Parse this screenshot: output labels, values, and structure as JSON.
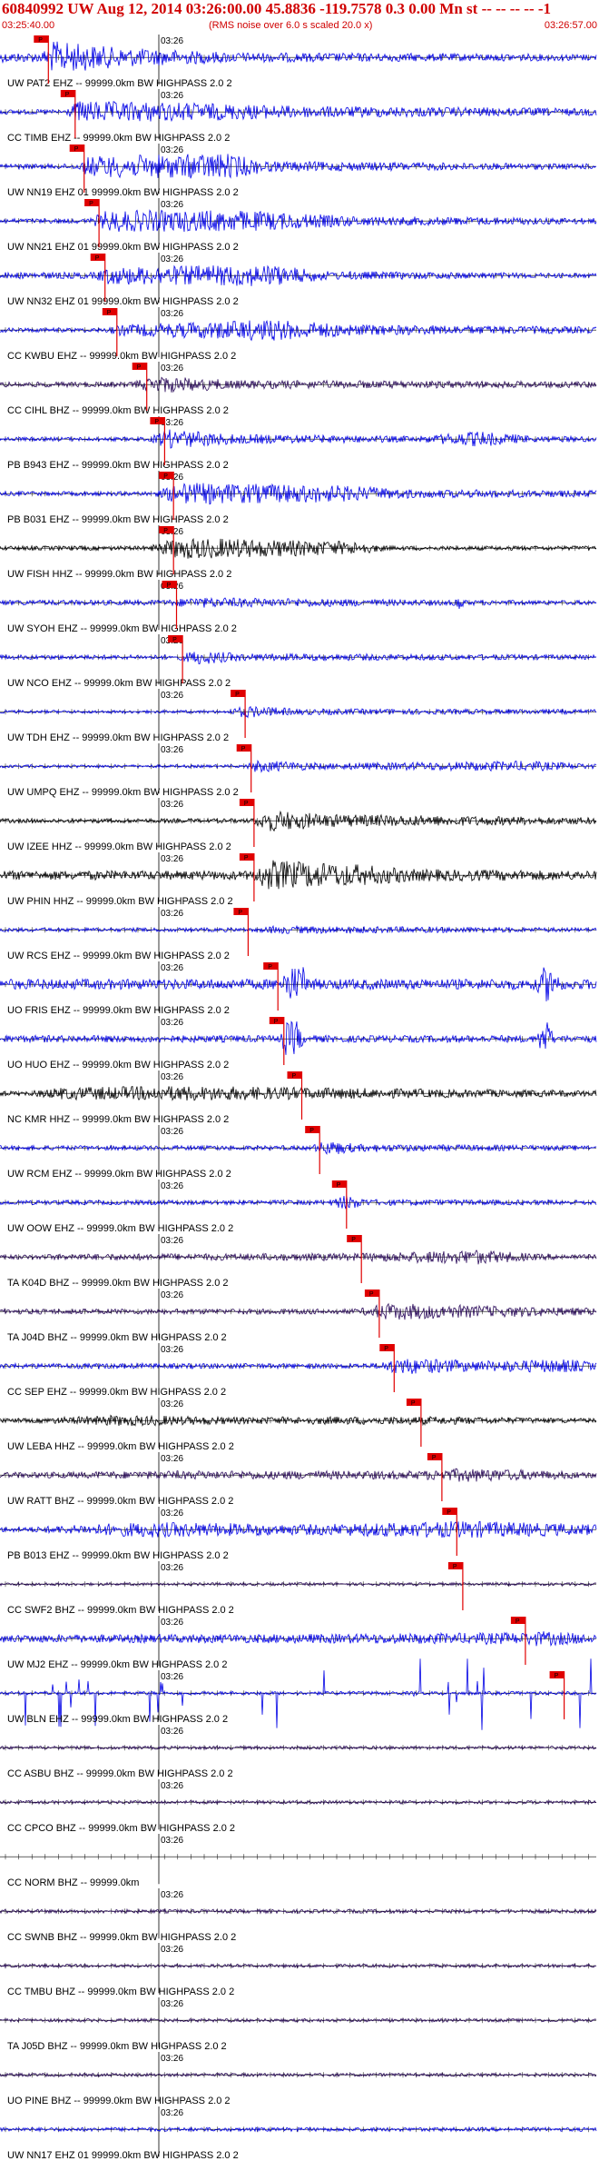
{
  "header": {
    "title": "60840992 UW Aug 12, 2014 03:26:00.00   45.8836 -119.7578  0.3 0.00 Mn st -- -- -- --  -1",
    "start_time": "03:25:40.00",
    "note": "(RMS noise over 6.0 s scaled 20.0 x)",
    "end_time": "03:26:57.00"
  },
  "colors": {
    "red": "#d00000",
    "blue": "#0000e6",
    "black": "#000000",
    "purple": "#2a0a5a",
    "pick": "#e00000"
  },
  "chart_data": {
    "type": "line",
    "time_label": "03:26",
    "pick_label": "P",
    "traces": [
      {
        "label": "UW PAT2 EHZ -- 99999.0km BW  HIGHPASS  2.0  2",
        "color": "blue",
        "amp": 3.0,
        "env": [
          [
            0.07,
            0.3
          ],
          [
            0.09,
            1.0
          ],
          [
            0.2,
            0.6
          ],
          [
            0.4,
            0.3
          ],
          [
            1.0,
            0.2
          ]
        ],
        "pick": 0.075
      },
      {
        "label": "CC TIMB EHZ -- 99999.0km BW  HIGHPASS  2.0  2",
        "color": "blue",
        "amp": 2.2,
        "env": [
          [
            0.11,
            0.2
          ],
          [
            0.13,
            0.9
          ],
          [
            0.3,
            0.8
          ],
          [
            0.5,
            0.5
          ],
          [
            1.0,
            0.3
          ]
        ],
        "pick": 0.12
      },
      {
        "label": "UW NN19 EHZ 01 99999.0km BW  HIGHPASS  2.0  2",
        "color": "blue",
        "amp": 2.4,
        "env": [
          [
            0.13,
            0.2
          ],
          [
            0.15,
            0.8
          ],
          [
            0.38,
            1.0
          ],
          [
            0.45,
            0.4
          ],
          [
            1.0,
            0.2
          ]
        ],
        "pick": 0.135
      },
      {
        "label": "UW NN21 EHZ 01 99999.0km BW  HIGHPASS  2.0  2",
        "color": "blue",
        "amp": 2.2,
        "env": [
          [
            0.15,
            0.2
          ],
          [
            0.18,
            0.9
          ],
          [
            0.4,
            0.9
          ],
          [
            0.6,
            0.4
          ],
          [
            1.0,
            0.25
          ]
        ],
        "pick": 0.16
      },
      {
        "label": "UW NN32 EHZ 01 99999.0km BW  HIGHPASS  2.0  2",
        "color": "blue",
        "amp": 2.0,
        "env": [
          [
            0.16,
            0.3
          ],
          [
            0.18,
            0.8
          ],
          [
            0.45,
            1.0
          ],
          [
            0.55,
            0.4
          ],
          [
            1.0,
            0.2
          ]
        ],
        "pick": 0.17
      },
      {
        "label": "CC KWBU EHZ -- 99999.0km BW  HIGHPASS  2.0  2",
        "color": "blue",
        "amp": 2.0,
        "env": [
          [
            0.18,
            0.2
          ],
          [
            0.2,
            0.5
          ],
          [
            0.45,
            1.0
          ],
          [
            0.6,
            0.5
          ],
          [
            1.0,
            0.3
          ]
        ],
        "pick": 0.19
      },
      {
        "label": "CC CIHL BHZ -- 99999.0km BW  HIGHPASS  2.0  2",
        "color": "purple",
        "amp": 1.6,
        "env": [
          [
            0.22,
            0.3
          ],
          [
            0.26,
            1.0
          ],
          [
            0.4,
            0.5
          ],
          [
            1.0,
            0.35
          ]
        ],
        "pick": 0.24
      },
      {
        "label": "PB B943 EHZ -- 99999.0km BW  HIGHPASS  2.0  2",
        "color": "blue",
        "amp": 1.8,
        "env": [
          [
            0.25,
            0.2
          ],
          [
            0.28,
            1.0
          ],
          [
            0.4,
            0.5
          ],
          [
            0.7,
            0.3
          ],
          [
            0.8,
            0.8
          ],
          [
            0.9,
            0.3
          ],
          [
            1.0,
            0.3
          ]
        ],
        "pick": 0.27
      },
      {
        "label": "PB B031 EHZ -- 99999.0km BW  HIGHPASS  2.0  2",
        "color": "blue",
        "amp": 2.0,
        "env": [
          [
            0.26,
            0.2
          ],
          [
            0.3,
            1.0
          ],
          [
            0.55,
            0.8
          ],
          [
            0.7,
            0.4
          ],
          [
            1.0,
            0.3
          ]
        ],
        "pick": 0.285
      },
      {
        "label": "UW FISH HHZ -- 99999.0km BW  HIGHPASS  2.0  2",
        "color": "black",
        "amp": 2.0,
        "env": [
          [
            0.25,
            0.2
          ],
          [
            0.3,
            1.0
          ],
          [
            0.45,
            0.8
          ],
          [
            0.6,
            0.6
          ],
          [
            0.65,
            0.2
          ],
          [
            1.0,
            0.2
          ]
        ],
        "pick": 0.285
      },
      {
        "label": "UW SYOH EHZ -- 99999.0km BW  HIGHPASS  2.0  2",
        "color": "blue",
        "amp": 1.6,
        "env": [
          [
            0.28,
            0.3
          ],
          [
            0.32,
            0.6
          ],
          [
            0.76,
            0.3
          ],
          [
            0.77,
            1.0
          ],
          [
            0.78,
            0.3
          ],
          [
            1.0,
            0.25
          ]
        ],
        "pick": 0.29
      },
      {
        "label": "UW NCO EHZ -- 99999.0km BW  HIGHPASS  2.0  2",
        "color": "blue",
        "amp": 1.4,
        "env": [
          [
            0.3,
            0.3
          ],
          [
            0.33,
            1.0
          ],
          [
            0.4,
            0.5
          ],
          [
            1.0,
            0.3
          ]
        ],
        "pick": 0.3
      },
      {
        "label": "UW TDH EHZ -- 99999.0km BW  HIGHPASS  2.0  2",
        "color": "blue",
        "amp": 1.4,
        "env": [
          [
            0.38,
            0.2
          ],
          [
            0.41,
            0.8
          ],
          [
            0.5,
            0.4
          ],
          [
            1.0,
            0.3
          ]
        ],
        "pick": 0.405
      },
      {
        "label": "UW UMPQ EHZ -- 99999.0km BW  HIGHPASS  2.0  2",
        "color": "blue",
        "amp": 1.4,
        "env": [
          [
            0.41,
            0.2
          ],
          [
            0.43,
            0.8
          ],
          [
            0.55,
            0.4
          ],
          [
            0.88,
            0.7
          ],
          [
            1.0,
            0.3
          ]
        ],
        "pick": 0.415
      },
      {
        "label": "UW IZEE HHZ -- 99999.0km BW  HIGHPASS  2.0  2",
        "color": "black",
        "amp": 2.0,
        "env": [
          [
            0.42,
            0.2
          ],
          [
            0.45,
            1.0
          ],
          [
            0.55,
            0.6
          ],
          [
            1.0,
            0.3
          ]
        ],
        "pick": 0.42
      },
      {
        "label": "UW PHIN HHZ -- 99999.0km BW  HIGHPASS  2.0  2",
        "color": "black",
        "amp": 2.8,
        "env": [
          [
            0.42,
            0.3
          ],
          [
            0.45,
            1.0
          ],
          [
            0.6,
            0.7
          ],
          [
            0.7,
            0.4
          ],
          [
            1.0,
            0.3
          ]
        ],
        "pick": 0.42
      },
      {
        "label": "UW RCS EHZ -- 99999.0km BW  HIGHPASS  2.0  2",
        "color": "blue",
        "amp": 1.2,
        "env": [
          [
            0.43,
            0.3
          ],
          [
            0.46,
            0.6
          ],
          [
            1.0,
            0.3
          ]
        ],
        "pick": 0.41
      },
      {
        "label": "UO FRIS EHZ -- 99999.0km BW  HIGHPASS  2.0  2",
        "color": "blue",
        "amp": 3.2,
        "env": [
          [
            0.47,
            0.3
          ],
          [
            0.48,
            1.0
          ],
          [
            0.51,
            1.0
          ],
          [
            0.52,
            0.3
          ],
          [
            0.9,
            0.3
          ],
          [
            0.91,
            1.0
          ],
          [
            0.93,
            1.0
          ],
          [
            0.94,
            0.3
          ],
          [
            1.0,
            0.3
          ]
        ],
        "pick": 0.46
      },
      {
        "label": "UO HUO EHZ -- 99999.0km BW  HIGHPASS  2.0  2",
        "color": "blue",
        "amp": 3.2,
        "env": [
          [
            0.47,
            0.2
          ],
          [
            0.48,
            1.0
          ],
          [
            0.5,
            1.0
          ],
          [
            0.51,
            0.2
          ],
          [
            0.9,
            0.2
          ],
          [
            0.91,
            1.0
          ],
          [
            0.92,
            1.0
          ],
          [
            0.93,
            0.2
          ],
          [
            1.0,
            0.2
          ]
        ],
        "pick": 0.47
      },
      {
        "label": "NC KMR HHZ -- 99999.0km BW  HIGHPASS  2.0  2",
        "color": "black",
        "amp": 1.4,
        "env": [
          [
            0.05,
            0.3
          ],
          [
            0.1,
            0.8
          ],
          [
            0.3,
            1.0
          ],
          [
            0.5,
            0.8
          ],
          [
            0.7,
            0.6
          ],
          [
            1.0,
            0.4
          ]
        ],
        "pick": 0.5
      },
      {
        "label": "UW RCM EHZ -- 99999.0km BW  HIGHPASS  2.0  2",
        "color": "blue",
        "amp": 1.4,
        "env": [
          [
            0.52,
            0.3
          ],
          [
            0.55,
            1.0
          ],
          [
            0.6,
            0.5
          ],
          [
            1.0,
            0.3
          ]
        ],
        "pick": 0.53
      },
      {
        "label": "UW OOW EHZ -- 99999.0km BW  HIGHPASS  2.0  2",
        "color": "blue",
        "amp": 1.4,
        "env": [
          [
            0.55,
            0.3
          ],
          [
            0.58,
            1.0
          ],
          [
            0.62,
            0.4
          ],
          [
            1.0,
            0.3
          ]
        ],
        "pick": 0.575
      },
      {
        "label": "TA K04D BHZ -- 99999.0km BW  HIGHPASS  2.0  2",
        "color": "purple",
        "amp": 1.4,
        "env": [
          [
            0.05,
            0.3
          ],
          [
            0.1,
            0.4
          ],
          [
            0.6,
            0.5
          ],
          [
            0.8,
            1.0
          ],
          [
            0.9,
            0.4
          ],
          [
            1.0,
            0.3
          ]
        ],
        "pick": 0.6
      },
      {
        "label": "TA J04D BHZ -- 99999.0km BW  HIGHPASS  2.0  2",
        "color": "purple",
        "amp": 1.6,
        "env": [
          [
            0.6,
            0.3
          ],
          [
            0.65,
            1.0
          ],
          [
            0.8,
            0.7
          ],
          [
            1.0,
            0.4
          ]
        ],
        "pick": 0.63
      },
      {
        "label": "CC SEP EHZ -- 99999.0km BW  HIGHPASS  2.0  2",
        "color": "blue",
        "amp": 1.6,
        "env": [
          [
            0.63,
            0.3
          ],
          [
            0.67,
            1.0
          ],
          [
            0.8,
            0.6
          ],
          [
            0.95,
            0.8
          ],
          [
            1.0,
            0.4
          ]
        ],
        "pick": 0.655
      },
      {
        "label": "UW LEBA HHZ -- 99999.0km BW  HIGHPASS  2.0  2",
        "color": "black",
        "amp": 1.3,
        "env": [
          [
            0.05,
            0.3
          ],
          [
            0.2,
            0.8
          ],
          [
            0.4,
            0.5
          ],
          [
            0.7,
            0.6
          ],
          [
            1.0,
            0.3
          ]
        ],
        "pick": 0.7
      },
      {
        "label": "UW RATT BHZ -- 99999.0km BW  HIGHPASS  2.0  2",
        "color": "purple",
        "amp": 1.3,
        "env": [
          [
            0.05,
            0.4
          ],
          [
            0.3,
            0.6
          ],
          [
            0.7,
            0.6
          ],
          [
            0.78,
            1.0
          ],
          [
            1.0,
            0.4
          ]
        ],
        "pick": 0.735
      },
      {
        "label": "PB B013 EHZ -- 99999.0km BW  HIGHPASS  2.0  2",
        "color": "blue",
        "amp": 1.6,
        "env": [
          [
            0.05,
            0.3
          ],
          [
            0.25,
            0.9
          ],
          [
            0.5,
            0.6
          ],
          [
            0.78,
            1.0
          ],
          [
            1.0,
            0.6
          ]
        ],
        "pick": 0.76
      },
      {
        "label": "CC SWF2 BHZ -- 99999.0km BW  HIGHPASS  2.0  2",
        "color": "purple",
        "amp": 0.9,
        "env": [
          [
            0.0,
            0.3
          ],
          [
            1.0,
            0.3
          ]
        ],
        "pick": 0.77
      },
      {
        "label": "UW MJ2 EHZ -- 99999.0km BW  HIGHPASS  2.0  2",
        "color": "blue",
        "amp": 1.4,
        "env": [
          [
            0.0,
            0.5
          ],
          [
            0.5,
            0.6
          ],
          [
            0.88,
            0.8
          ],
          [
            0.9,
            1.0
          ],
          [
            1.0,
            0.6
          ]
        ],
        "pick": 0.875
      },
      {
        "label": "UW BLN EHZ -- 99999.0km BW  HIGHPASS  2.0  2",
        "color": "blue",
        "amp": 1.6,
        "env": [
          [
            0.0,
            0.2
          ],
          [
            1.0,
            0.2
          ]
        ],
        "spikes": true,
        "pick": 0.94
      },
      {
        "label": "CC ASBU BHZ -- 99999.0km BW  HIGHPASS  2.0  2",
        "color": "purple",
        "amp": 0.6,
        "env": [
          [
            0.0,
            0.5
          ],
          [
            1.0,
            0.5
          ]
        ]
      },
      {
        "label": "CC CPCO BHZ -- 99999.0km BW  HIGHPASS  2.0  2",
        "color": "purple",
        "amp": 0.6,
        "env": [
          [
            0.0,
            0.5
          ],
          [
            1.0,
            0.5
          ]
        ]
      },
      {
        "label": "CC NORM BHZ -- 99999.0km",
        "color": "purple",
        "amp": 0.0,
        "env": [
          [
            0.0,
            0.0
          ],
          [
            1.0,
            0.0
          ]
        ]
      },
      {
        "label": "CC SWNB BHZ -- 99999.0km BW  HIGHPASS  2.0  2",
        "color": "purple",
        "amp": 0.7,
        "env": [
          [
            0.0,
            0.5
          ],
          [
            1.0,
            0.5
          ]
        ]
      },
      {
        "label": "CC TMBU BHZ -- 99999.0km BW  HIGHPASS  2.0  2",
        "color": "purple",
        "amp": 0.6,
        "env": [
          [
            0.0,
            0.5
          ],
          [
            1.0,
            0.5
          ]
        ]
      },
      {
        "label": "TA J05D BHZ -- 99999.0km BW  HIGHPASS  2.0  2",
        "color": "purple",
        "amp": 0.6,
        "env": [
          [
            0.0,
            0.5
          ],
          [
            1.0,
            0.5
          ]
        ]
      },
      {
        "label": "UO PINE BHZ -- 99999.0km BW  HIGHPASS  2.0  2",
        "color": "purple",
        "amp": 0.6,
        "env": [
          [
            0.0,
            0.5
          ],
          [
            1.0,
            0.5
          ]
        ]
      },
      {
        "label": "UW NN17 EHZ 01 99999.0km BW  HIGHPASS  2.0  2",
        "color": "blue",
        "amp": 0.7,
        "env": [
          [
            0.0,
            0.5
          ],
          [
            1.0,
            0.5
          ]
        ]
      }
    ]
  }
}
